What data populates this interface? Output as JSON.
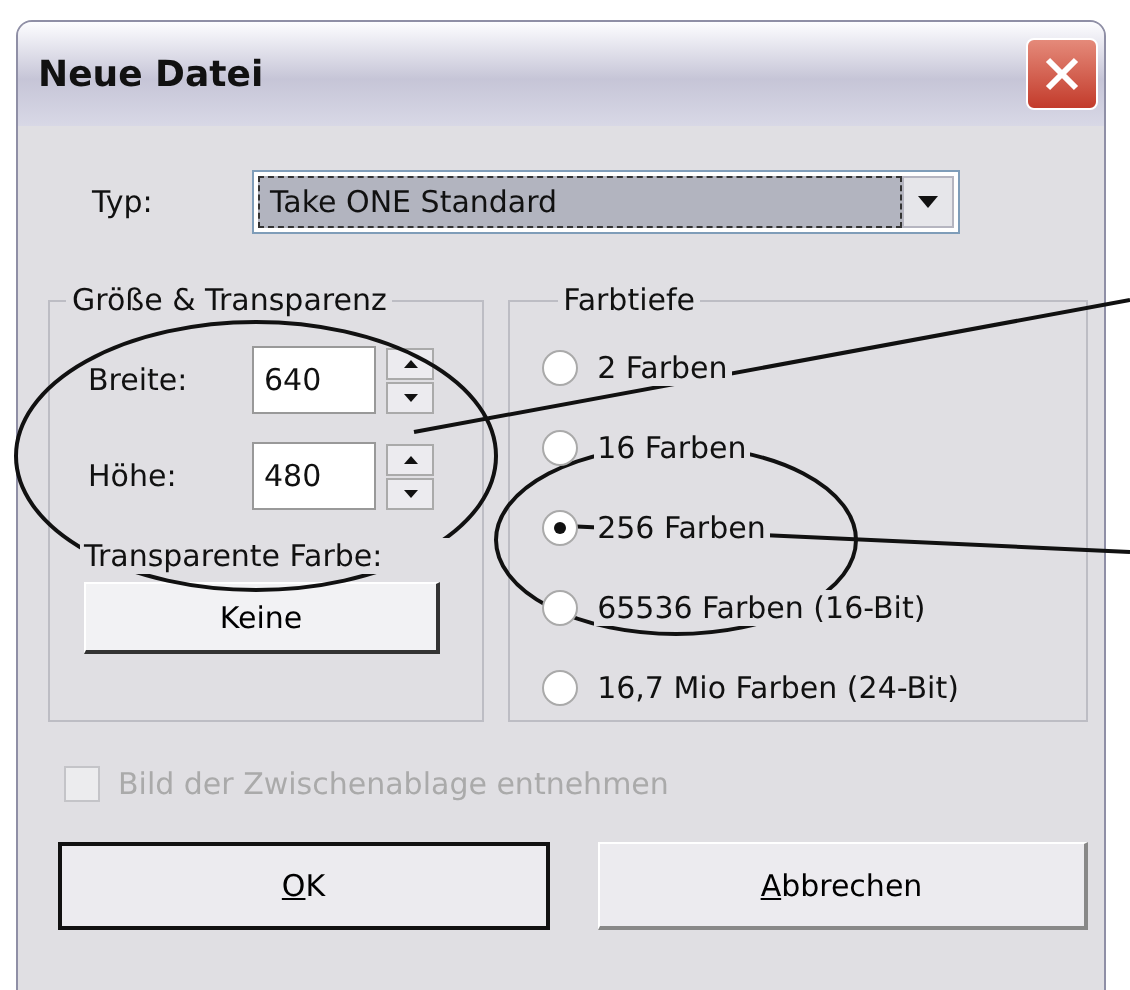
{
  "window": {
    "title": "Neue Datei"
  },
  "type_field": {
    "label": "Typ:",
    "value": "Take ONE Standard",
    "focused": true
  },
  "size_group": {
    "title": "Größe & Transparenz",
    "fields": [
      {
        "label": "Breite:",
        "value": "640"
      },
      {
        "label": "Höhe:",
        "value": "480"
      }
    ],
    "transparent_label": "Transparente Farbe:",
    "transparent_button": "Keine"
  },
  "color_group": {
    "title": "Farbtiefe",
    "options": [
      {
        "label": "2 Farben",
        "selected": false
      },
      {
        "label": "16 Farben",
        "selected": false
      },
      {
        "label": "256 Farben",
        "selected": true
      },
      {
        "label": "65536 Farben (16-Bit)",
        "selected": false
      },
      {
        "label": "16,7 Mio Farben (24-Bit)",
        "selected": false
      }
    ]
  },
  "clipboard_checkbox": {
    "label": "Bild der Zwischenablage entnehmen",
    "checked": false,
    "disabled": true
  },
  "buttons": [
    {
      "label": "OK",
      "default": true,
      "underlined_first_letter": true
    },
    {
      "label": "Abbrechen",
      "default": false,
      "underlined_first_letter": true
    }
  ]
}
